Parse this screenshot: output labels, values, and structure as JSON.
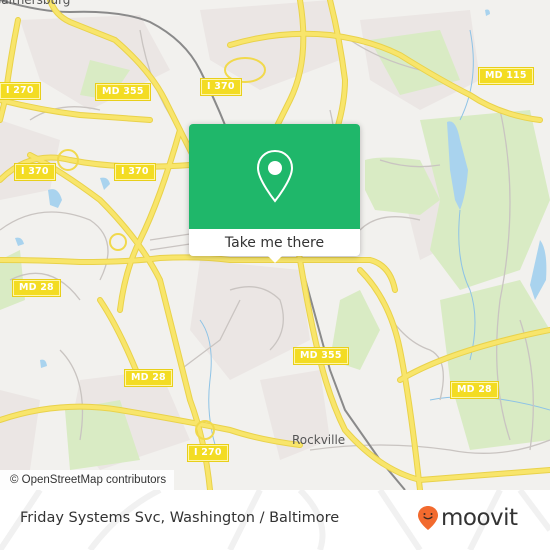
{
  "map": {
    "place_labels": [
      {
        "id": "gaithersburg",
        "text": "Gaithersburg"
      },
      {
        "id": "rockville",
        "text": "Rockville"
      }
    ],
    "road_shields": [
      {
        "id": "i270-north",
        "text": "I 270"
      },
      {
        "id": "md355-north",
        "text": "MD 355"
      },
      {
        "id": "i370-east",
        "text": "I 370"
      },
      {
        "id": "md115",
        "text": "MD 115"
      },
      {
        "id": "i370-west",
        "text": "I 370"
      },
      {
        "id": "i370-center",
        "text": "I 370"
      },
      {
        "id": "md28-west",
        "text": "MD 28"
      },
      {
        "id": "md28-center",
        "text": "MD 28"
      },
      {
        "id": "md355-south",
        "text": "MD 355"
      },
      {
        "id": "md28-east",
        "text": "MD 28"
      },
      {
        "id": "i270-south",
        "text": "I 270"
      }
    ],
    "attribution": "© OpenStreetMap contributors",
    "colors": {
      "background": "#f2f1ee",
      "highway": "#f6e15a",
      "park": "#d9ebc4",
      "water": "#a9d3ee",
      "residential": "#ebe6e4"
    }
  },
  "popup": {
    "icon": "location-pin-icon",
    "button_label": "Take me there",
    "color": "#1fb76a"
  },
  "footer": {
    "title": "Friday Systems Svc, Washington / Baltimore",
    "logo_text": "moovit",
    "logo_color": "#f26a2e"
  }
}
